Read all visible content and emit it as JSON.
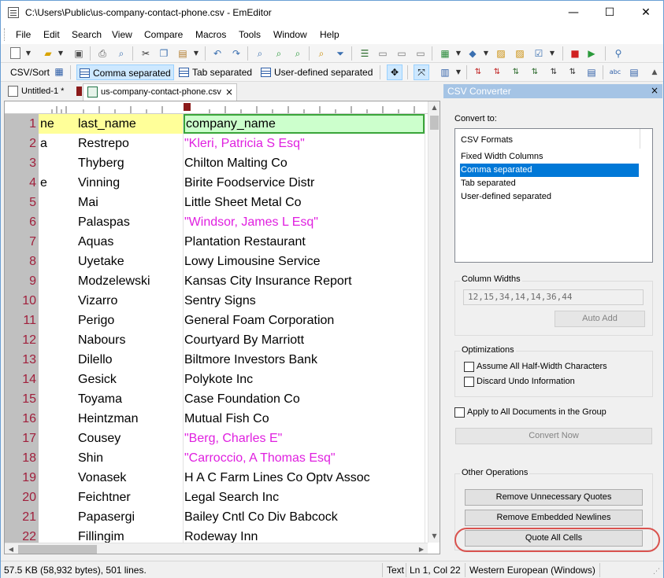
{
  "window": {
    "title": "C:\\Users\\Public\\us-company-contact-phone.csv - EmEditor",
    "minimize": "—",
    "maximize": "☐",
    "close": "✕"
  },
  "menu": [
    "File",
    "Edit",
    "Search",
    "View",
    "Compare",
    "Macros",
    "Tools",
    "Window",
    "Help"
  ],
  "csv_toolbar": {
    "label": "CSV/Sort",
    "modes": [
      "Comma separated",
      "Tab separated",
      "User-defined separated"
    ],
    "active_mode": "Comma separated"
  },
  "tabs": [
    {
      "label": "Untitled-1 *"
    },
    {
      "label": "us-company-contact-phone.csv",
      "close": "×"
    }
  ],
  "editor": {
    "header": {
      "line": "1",
      "c0": "ne",
      "c1": "last_name",
      "c2": "company_name"
    },
    "rows": [
      {
        "line": "2",
        "c0": "a",
        "c1": "Restrepo",
        "c2": "\"Kleri, Patricia S Esq\"",
        "quoted": true
      },
      {
        "line": "3",
        "c0": "",
        "c1": "Thyberg",
        "c2": "Chilton Malting Co",
        "quoted": false
      },
      {
        "line": "4",
        "c0": "e",
        "c1": "Vinning",
        "c2": "Birite Foodservice Distr",
        "quoted": false
      },
      {
        "line": "5",
        "c0": "",
        "c1": "Mai",
        "c2": "Little Sheet Metal Co",
        "quoted": false
      },
      {
        "line": "6",
        "c0": "",
        "c1": "Palaspas",
        "c2": "\"Windsor, James L Esq\"",
        "quoted": true
      },
      {
        "line": "7",
        "c0": "",
        "c1": "Aquas",
        "c2": "Plantation Restaurant",
        "quoted": false
      },
      {
        "line": "8",
        "c0": "",
        "c1": "Uyetake",
        "c2": "Lowy Limousine Service",
        "quoted": false
      },
      {
        "line": "9",
        "c0": "",
        "c1": "Modzelewski",
        "c2": "Kansas City Insurance Report",
        "quoted": false
      },
      {
        "line": "10",
        "c0": "",
        "c1": "Vizarro",
        "c2": "Sentry Signs",
        "quoted": false
      },
      {
        "line": "11",
        "c0": "",
        "c1": "Perigo",
        "c2": "General Foam Corporation",
        "quoted": false
      },
      {
        "line": "12",
        "c0": "",
        "c1": "Nabours",
        "c2": "Courtyard By Marriott",
        "quoted": false
      },
      {
        "line": "13",
        "c0": "",
        "c1": "Dilello",
        "c2": "Biltmore Investors Bank",
        "quoted": false
      },
      {
        "line": "14",
        "c0": "",
        "c1": "Gesick",
        "c2": "Polykote Inc",
        "quoted": false
      },
      {
        "line": "15",
        "c0": "",
        "c1": "Toyama",
        "c2": "Case Foundation Co",
        "quoted": false
      },
      {
        "line": "16",
        "c0": "",
        "c1": "Heintzman",
        "c2": "Mutual Fish Co",
        "quoted": false
      },
      {
        "line": "17",
        "c0": "",
        "c1": "Cousey",
        "c2": "\"Berg, Charles E\"",
        "quoted": true
      },
      {
        "line": "18",
        "c0": "",
        "c1": "Shin",
        "c2": "\"Carroccio, A Thomas Esq\"",
        "quoted": true
      },
      {
        "line": "19",
        "c0": "",
        "c1": "Vonasek",
        "c2": "H A C Farm Lines Co Optv Assoc",
        "quoted": false
      },
      {
        "line": "20",
        "c0": "",
        "c1": "Feichtner",
        "c2": "Legal Search Inc",
        "quoted": false
      },
      {
        "line": "21",
        "c0": "",
        "c1": "Papasergi",
        "c2": "Bailey Cntl Co Div Babcock",
        "quoted": false
      },
      {
        "line": "22",
        "c0": "",
        "c1": "Fillingim",
        "c2": "Rodeway Inn",
        "quoted": false
      }
    ]
  },
  "converter": {
    "title": "CSV Converter",
    "close": "×",
    "convert_to_label": "Convert to:",
    "list": [
      "CSV Formats",
      "Fixed Width Columns",
      "Comma separated",
      "Tab separated",
      "User-defined separated"
    ],
    "selected": "Comma separated",
    "column_widths_label": "Column Widths",
    "column_widths_value": "12,15,34,14,14,36,44",
    "auto_add": "Auto Add",
    "optimizations_label": "Optimizations",
    "assume_half_width": "Assume All Half-Width Characters",
    "discard_undo": "Discard Undo Information",
    "apply_all": "Apply to All Documents in the Group",
    "convert_now": "Convert Now",
    "other_ops_label": "Other Operations",
    "remove_quotes": "Remove Unnecessary Quotes",
    "remove_newlines": "Remove Embedded Newlines",
    "quote_all": "Quote All Cells"
  },
  "status": {
    "size": "57.5 KB (58,932 bytes), 501 lines.",
    "mode": "Text",
    "position": "Ln 1, Col 22",
    "encoding": "Western European (Windows)"
  },
  "colors": {
    "quoted_text": "#e020e0",
    "line_numbers": "#a0203c",
    "header_cell": "#ffff99",
    "active_cell": "#ccffcc",
    "selection": "#0078d7",
    "annotation": "#d9534f"
  }
}
